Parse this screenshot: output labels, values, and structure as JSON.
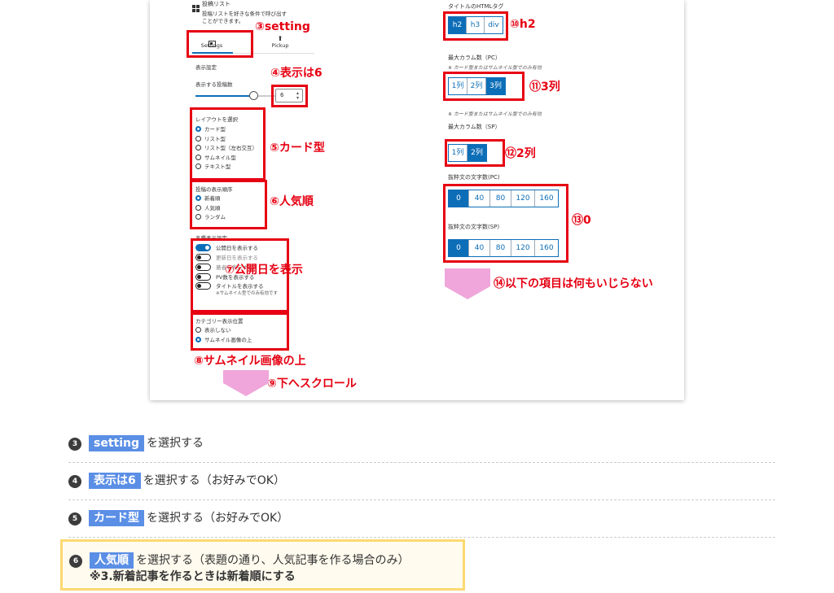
{
  "left_panel": {
    "post_list_title": "投稿リスト",
    "post_list_desc1": "投稿リストを好きな条件で呼び出す",
    "post_list_desc2": "ことができます。",
    "tabs": [
      {
        "label": "Settings",
        "active": true
      },
      {
        "label": "Pickup",
        "active": false
      }
    ],
    "display_settings_label": "表示設定",
    "post_count_label": "表示する投稿数",
    "post_count_value": "6",
    "layout_label": "レイアウトを選択",
    "layout_options": [
      {
        "label": "カード型",
        "selected": true
      },
      {
        "label": "リスト型",
        "selected": false
      },
      {
        "label": "リスト型（左右交互）",
        "selected": false
      },
      {
        "label": "サムネイル型",
        "selected": false
      },
      {
        "label": "テキスト型",
        "selected": false
      }
    ],
    "order_label": "投稿の表示順序",
    "order_options": [
      {
        "label": "新着順",
        "selected": true
      },
      {
        "label": "人気順",
        "selected": false
      },
      {
        "label": "ランダム",
        "selected": false
      }
    ],
    "item_display_label": "各種表示設定",
    "toggles": [
      {
        "label": "公開日を表示する",
        "on": true
      },
      {
        "label": "更新日を表示する",
        "on": false
      },
      {
        "label": "著者を表示する",
        "on": false
      },
      {
        "label": "PV数を表示する",
        "on": false
      },
      {
        "label": "タイトルを表示する",
        "on": false,
        "note": "※サムネイル型でのみ有効です"
      }
    ],
    "category_pos_label": "カテゴリー表示位置",
    "category_options": [
      {
        "label": "表示しない",
        "selected": false
      },
      {
        "label": "サムネイル画像の上",
        "selected": true
      }
    ]
  },
  "right_panel": {
    "title_tag_label": "タイトルのHTMLタグ",
    "title_tags": [
      {
        "label": "h2",
        "on": true
      },
      {
        "label": "h3",
        "on": false
      },
      {
        "label": "div",
        "on": false
      }
    ],
    "max_col_pc_label": "最大カラム数（PC）",
    "col_note": "※ カード型またはサムネイル型でのみ有効",
    "cols_pc": [
      {
        "label": "1列",
        "on": false
      },
      {
        "label": "2列",
        "on": false
      },
      {
        "label": "3列",
        "on": true
      }
    ],
    "max_col_sp_label": "最大カラム数（SP）",
    "cols_sp": [
      {
        "label": "1列",
        "on": false
      },
      {
        "label": "2列",
        "on": true
      }
    ],
    "excerpt_pc_label": "抜粋文の文字数(PC)",
    "excerpt_pc": [
      {
        "label": "0",
        "on": true
      },
      {
        "label": "40",
        "on": false
      },
      {
        "label": "80",
        "on": false
      },
      {
        "label": "120",
        "on": false
      },
      {
        "label": "160",
        "on": false
      }
    ],
    "excerpt_sp_label": "抜粋文の文字数(SP)",
    "excerpt_sp": [
      {
        "label": "0",
        "on": true
      },
      {
        "label": "40",
        "on": false
      },
      {
        "label": "80",
        "on": false
      },
      {
        "label": "120",
        "on": false
      },
      {
        "label": "160",
        "on": false
      }
    ]
  },
  "annotations": {
    "a3": "③setting",
    "a4": "④表示は6",
    "a5": "⑤カード型",
    "a6": "⑥人気順",
    "a7": "⑦公開日を表示",
    "a8": "⑧サムネイル画像の上",
    "a9": "⑨下へスクロール",
    "a10": "⑩h2",
    "a11": "⑪3列",
    "a12": "⑫2列",
    "a13": "⑬0",
    "a14": "⑭以下の項目は何もいじらない"
  },
  "steps": [
    {
      "num": "3",
      "highlight": "setting",
      "text": "を選択する"
    },
    {
      "num": "4",
      "highlight": "表示は6",
      "text": "を選択する（お好みでOK）"
    },
    {
      "num": "5",
      "highlight": "カード型",
      "text": "を選択する（お好みでOK）"
    },
    {
      "num": "6",
      "highlight": "人気順",
      "text": "を選択する（表題の通り、人気記事を作る場合のみ）",
      "sub": "※3.新着記事を作るときは新着順にする"
    }
  ],
  "colors": {
    "accent_blue": "#0d6eb8",
    "annotation_red": "#e60012",
    "arrow_pink": "#f0a6db",
    "highlight_blue": "#5b8fe6",
    "note_border": "#fcd971"
  }
}
